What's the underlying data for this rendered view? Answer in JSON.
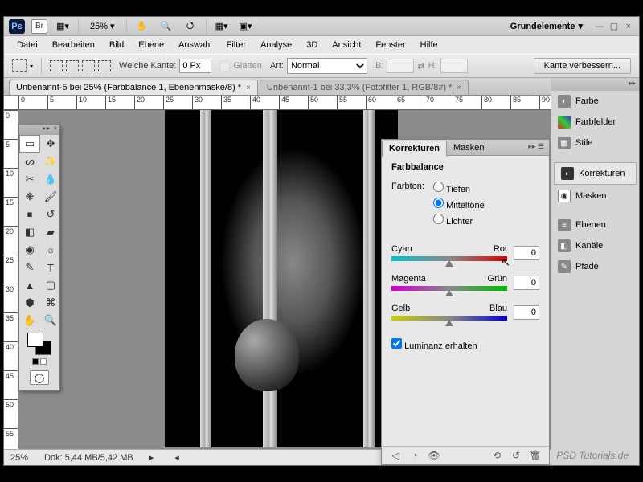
{
  "app": {
    "workspace": "Grundelemente",
    "zoom_header": "25%"
  },
  "menu": {
    "datei": "Datei",
    "bearbeiten": "Bearbeiten",
    "bild": "Bild",
    "ebene": "Ebene",
    "auswahl": "Auswahl",
    "filter": "Filter",
    "analyse": "Analyse",
    "d3": "3D",
    "ansicht": "Ansicht",
    "fenster": "Fenster",
    "hilfe": "Hilfe"
  },
  "options": {
    "weiche_kante": "Weiche Kante:",
    "weiche_kante_val": "0 Px",
    "glaetten": "Glätten",
    "art": "Art:",
    "art_val": "Normal",
    "b": "B:",
    "h": "H:",
    "improve": "Kante verbessern..."
  },
  "tabs": {
    "t1": "Unbenannt-5 bei 25% (Farbbalance 1, Ebenenmaske/8) *",
    "t2": "Unbenannt-1 bei 33,3% (Fotofilter 1, RGB/8#) *"
  },
  "right": {
    "farbe": "Farbe",
    "farbfelder": "Farbfelder",
    "stile": "Stile",
    "korrekturen": "Korrekturen",
    "masken": "Masken",
    "ebenen": "Ebenen",
    "kanaele": "Kanäle",
    "pfade": "Pfade"
  },
  "correct": {
    "tab_korrekturen": "Korrekturen",
    "tab_masken": "Masken",
    "title": "Farbbalance",
    "farbton": "Farbton:",
    "tiefen": "Tiefen",
    "mitteltoene": "Mitteltöne",
    "lichter": "Lichter",
    "cyan": "Cyan",
    "rot": "Rot",
    "val_cr": "0",
    "magenta": "Magenta",
    "gruen": "Grün",
    "val_mg": "0",
    "gelb": "Gelb",
    "blau": "Blau",
    "val_yb": "0",
    "lum": "Luminanz erhalten"
  },
  "ruler_h": [
    "0",
    "5",
    "10",
    "15",
    "20",
    "25",
    "30",
    "35",
    "40",
    "45",
    "50",
    "55",
    "60",
    "65",
    "70",
    "75",
    "80",
    "85",
    "90"
  ],
  "ruler_v": [
    "0",
    "5",
    "10",
    "15",
    "20",
    "25",
    "30",
    "35",
    "40",
    "45",
    "50",
    "55"
  ],
  "status": {
    "zoom": "25%",
    "doksize_label": "Dok:",
    "doksize": "5,44 MB/5,42 MB"
  },
  "watermark": "PSD Tutorials.de"
}
